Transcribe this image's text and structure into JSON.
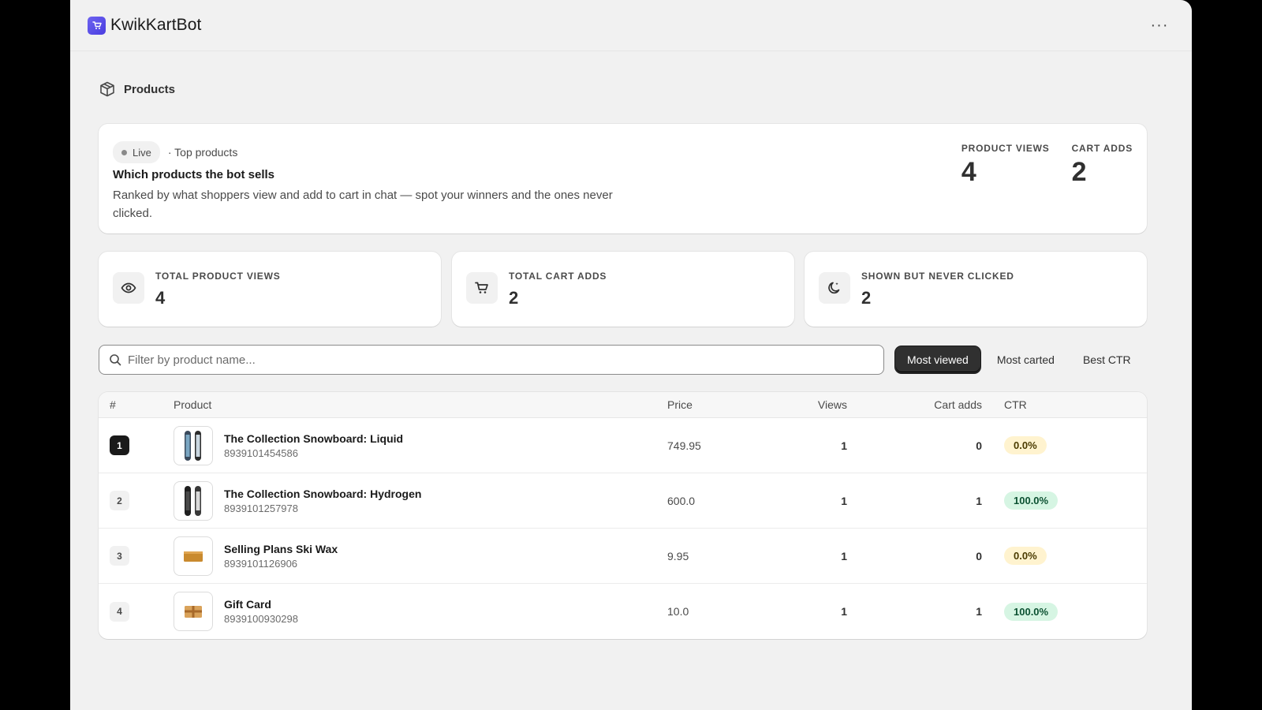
{
  "app": {
    "title": "KwikKartBot",
    "more_label": "···"
  },
  "page": {
    "title": "Products"
  },
  "hero": {
    "live_label": "Live",
    "subtitle": "· Top products",
    "heading": "Which products the bot sells",
    "description": "Ranked by what shoppers view and add to cart in chat — spot your winners and the ones never clicked.",
    "stats": [
      {
        "label": "PRODUCT VIEWS",
        "value": "4"
      },
      {
        "label": "CART ADDS",
        "value": "2"
      }
    ]
  },
  "kpis": [
    {
      "label": "TOTAL PRODUCT VIEWS",
      "value": "4",
      "icon": "eye-icon"
    },
    {
      "label": "TOTAL CART ADDS",
      "value": "2",
      "icon": "cart-icon"
    },
    {
      "label": "SHOWN BUT NEVER CLICKED",
      "value": "2",
      "icon": "moon-icon"
    }
  ],
  "filter": {
    "placeholder": "Filter by product name..."
  },
  "sort_options": [
    "Most viewed",
    "Most carted",
    "Best CTR"
  ],
  "table": {
    "headers": {
      "rank": "#",
      "product": "Product",
      "price": "Price",
      "views": "Views",
      "carts": "Cart adds",
      "ctr": "CTR"
    },
    "rows": [
      {
        "rank": "1",
        "name": "The Collection Snowboard: Liquid",
        "id": "8939101454586",
        "price": "749.95",
        "views": "1",
        "carts": "0",
        "ctr": "0.0%"
      },
      {
        "rank": "2",
        "name": "The Collection Snowboard: Hydrogen",
        "id": "8939101257978",
        "price": "600.0",
        "views": "1",
        "carts": "1",
        "ctr": "100.0%"
      },
      {
        "rank": "3",
        "name": "Selling Plans Ski Wax",
        "id": "8939101126906",
        "price": "9.95",
        "views": "1",
        "carts": "0",
        "ctr": "0.0%"
      },
      {
        "rank": "4",
        "name": "Gift Card",
        "id": "8939100930298",
        "price": "10.0",
        "views": "1",
        "carts": "1",
        "ctr": "100.0%"
      }
    ]
  },
  "colors": {
    "accent": "#303030",
    "logo": "#5b50e8",
    "ctr_low_bg": "#fff3cf",
    "ctr_high_bg": "#d6f5e3"
  }
}
